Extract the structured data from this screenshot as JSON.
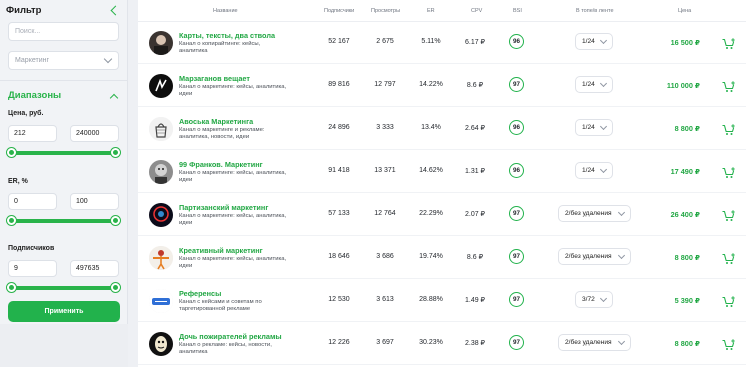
{
  "sidebar": {
    "title": "Фильтр",
    "search_placeholder": "Поиск...",
    "category": "Маркетинг",
    "ranges_title": "Диапазоны",
    "price": {
      "label": "Цена, руб.",
      "min": "212",
      "max": "240000"
    },
    "er": {
      "label": "ER, %",
      "min": "0",
      "max": "100"
    },
    "subs": {
      "label": "Подписчиков",
      "min": "9",
      "max": "497635"
    },
    "apply_label": "Применить"
  },
  "table": {
    "headers": {
      "name": "Название",
      "subs": "Подписчики",
      "views": "Просмотры",
      "er": "ER",
      "cpv": "CPV",
      "bsi": "BSI",
      "top": "В топе/в ленте",
      "price": "Цена"
    },
    "rows": [
      {
        "name": "Карты, тексты, два ствола",
        "desc": "Канал о копирайтинге: кейсы, аналитика",
        "subs": "52 167",
        "views": "2 675",
        "er": "5.11%",
        "cpv": "6.17 ₽",
        "bsi": "96",
        "top": "1/24",
        "price": "16 500 ₽",
        "avatar": "person-dark"
      },
      {
        "name": "Марзаганов вещает",
        "desc": "Канал о маркетинге: кейсы, аналитика, идеи",
        "subs": "89 816",
        "views": "12 797",
        "er": "14.22%",
        "cpv": "8.6 ₽",
        "bsi": "97",
        "top": "1/24",
        "price": "110 000 ₽",
        "avatar": "black-logo"
      },
      {
        "name": "Авоська Маркетинга",
        "desc": "Канал о маркетинге и рекламе: аналитика, новости, идеи",
        "subs": "24 896",
        "views": "3 333",
        "er": "13.4%",
        "cpv": "2.64 ₽",
        "bsi": "96",
        "top": "1/24",
        "price": "8 800 ₽",
        "avatar": "bag"
      },
      {
        "name": "99 Франков. Маркетинг",
        "desc": "Канал о маркетинге: кейсы, аналитика, идеи",
        "subs": "91 418",
        "views": "13 371",
        "er": "14.62%",
        "cpv": "1.31 ₽",
        "bsi": "96",
        "top": "1/24",
        "price": "17 490 ₽",
        "avatar": "portrait"
      },
      {
        "name": "Партизанский маркетинг",
        "desc": "Канал о маркетинге: кейсы, аналитика, идеи",
        "subs": "57 133",
        "views": "12 764",
        "er": "22.29%",
        "cpv": "2.07 ₽",
        "bsi": "97",
        "top": "2/без удаления",
        "price": "26 400 ₽",
        "avatar": "neon"
      },
      {
        "name": "Креативный маркетинг",
        "desc": "Канал о маркетинге: кейсы, аналитика, идеи",
        "subs": "18 646",
        "views": "3 686",
        "er": "19.74%",
        "cpv": "8.6 ₽",
        "bsi": "97",
        "top": "2/без удаления",
        "price": "8 800 ₽",
        "avatar": "figure"
      },
      {
        "name": "Референсы",
        "desc": "Канал с кейсами и советам по таргетированной рекламе",
        "subs": "12 530",
        "views": "3 613",
        "er": "28.88%",
        "cpv": "1.49 ₽",
        "bsi": "97",
        "top": "3/72",
        "price": "5 390 ₽",
        "avatar": "blue-logo"
      },
      {
        "name": "Дочь пожирателей рекламы",
        "desc": "Канал о рекламе: кейсы, новости, аналитика",
        "subs": "12 226",
        "views": "3 697",
        "er": "30.23%",
        "cpv": "2.38 ₽",
        "bsi": "97",
        "top": "2/без удаления",
        "price": "8 800 ₽",
        "avatar": "mask"
      }
    ]
  },
  "colors": {
    "accent": "#29b34a",
    "price": "#22a744"
  }
}
